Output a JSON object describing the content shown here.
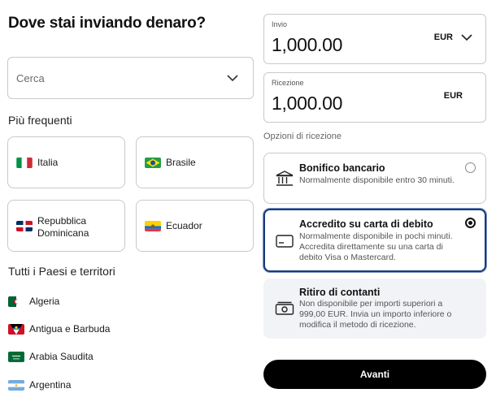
{
  "page": {
    "title": "Dove stai inviando denaro?"
  },
  "search": {
    "placeholder": "Cerca",
    "icon": "chevron-down-icon"
  },
  "frequent": {
    "label": "Più frequenti",
    "countries": [
      {
        "name": "Italia",
        "flag": "flag-italy"
      },
      {
        "name": "Brasile",
        "flag": "flag-brazil"
      },
      {
        "name": "Repubblica\nDominicana",
        "flag": "flag-dominican-republic"
      },
      {
        "name": "Ecuador",
        "flag": "flag-ecuador"
      }
    ]
  },
  "all": {
    "label": "Tutti i Paesi e territori",
    "countries": [
      {
        "name": "Algeria",
        "flag": "flag-algeria"
      },
      {
        "name": "Antigua e Barbuda",
        "flag": "flag-antigua-and-barbuda"
      },
      {
        "name": "Arabia Saudita",
        "flag": "flag-saudi-arabia"
      },
      {
        "name": "Argentina",
        "flag": "flag-argentina"
      }
    ]
  },
  "send": {
    "label": "Invio",
    "amount": "1,000.00",
    "currency": "EUR"
  },
  "receive": {
    "label": "Ricezione",
    "amount": "1,000.00",
    "currency": "EUR"
  },
  "options": {
    "label": "Opzioni di ricezione",
    "items": [
      {
        "title": "Bonifico bancario",
        "desc": "Normalmente disponibile entro 30 minuti.",
        "icon": "bank-icon",
        "selected": false
      },
      {
        "title": "Accredito su carta di debito",
        "desc": "Normalmente disponibile in pochi minuti. Accredita direttamente su una carta di debito Visa o Mastercard.",
        "icon": "card-icon",
        "selected": true
      },
      {
        "title": "Ritiro di contanti",
        "desc": "Non disponibile per importi superiori a 999,00 EUR. Invia un importo inferiore o modifica il metodo di ricezione.",
        "icon": "cash-icon",
        "selected": false,
        "disabled": true
      }
    ]
  },
  "cta": {
    "label": "Avanti"
  },
  "colors": {
    "selected_border": "#1a3a7a",
    "disabled_bg": "#f2f3f6",
    "button_bg": "#000000"
  }
}
